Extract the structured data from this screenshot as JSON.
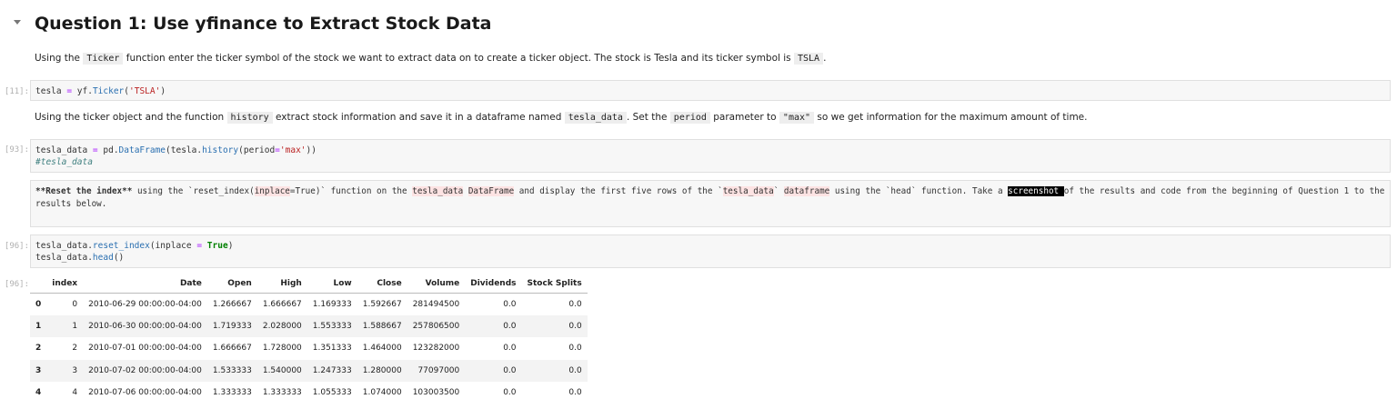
{
  "heading": "Question 1: Use yfinance to Extract Stock Data",
  "md1": {
    "a": "Using the",
    "code1": "Ticker",
    "b": "function enter the ticker symbol of the stock we want to extract data on to create a ticker object. The stock is Tesla and its ticker symbol is",
    "code2": "TSLA",
    "c": "."
  },
  "cell1": {
    "prompt": "[11]:",
    "line_a": "tesla ",
    "eq": "=",
    "line_b": " yf.",
    "fn": "Ticker",
    "line_c": "(",
    "str": "'TSLA'",
    "line_d": ")"
  },
  "md2": {
    "a": "Using the ticker object and the function",
    "code1": "history",
    "b": "extract stock information and save it in a dataframe named",
    "code2": "tesla_data",
    "c": ". Set the",
    "code3": "period",
    "d": "parameter to",
    "code4": "\"max\"",
    "e": "so we get information for the maximum amount of time."
  },
  "cell2": {
    "prompt": "[93]:",
    "a": "tesla_data ",
    "eq": "=",
    "b": " pd.",
    "fn1": "DataFrame",
    "c": "(tesla.",
    "fn2": "history",
    "d": "(period",
    "eq2": "=",
    "str": "'max'",
    "e": "))",
    "comment": "#tesla_data"
  },
  "cell3": {
    "t1": "**Reset the index**",
    "t2": " using the `reset_index(",
    "t3": "inplace",
    "t4": "=True)` function on the ",
    "t5": "tesla_data",
    "t6": " ",
    "t7": "DataFrame",
    "t8": " and display the first five rows of the `",
    "t9": "tesla_data",
    "t10": "` ",
    "t11": "dataframe",
    "t12": " using the `head` function. Take a ",
    "t13": "screenshot ",
    "t14": "of the results and code from the beginning of Question 1 to the results below."
  },
  "cell4": {
    "prompt": "[96]:",
    "l1a": "tesla_data.",
    "l1fn": "reset_index",
    "l1b": "(inplace ",
    "l1eq": "=",
    "l1c": " ",
    "l1kw": "True",
    "l1d": ")",
    "l2a": "tesla_data.",
    "l2fn": "head",
    "l2b": "()"
  },
  "output_prompt": "[96]:",
  "table": {
    "columns": [
      "",
      "index",
      "Date",
      "Open",
      "High",
      "Low",
      "Close",
      "Volume",
      "Dividends",
      "Stock Splits"
    ],
    "rows": [
      [
        "0",
        "0",
        "2010-06-29 00:00:00-04:00",
        "1.266667",
        "1.666667",
        "1.169333",
        "1.592667",
        "281494500",
        "0.0",
        "0.0"
      ],
      [
        "1",
        "1",
        "2010-06-30 00:00:00-04:00",
        "1.719333",
        "2.028000",
        "1.553333",
        "1.588667",
        "257806500",
        "0.0",
        "0.0"
      ],
      [
        "2",
        "2",
        "2010-07-01 00:00:00-04:00",
        "1.666667",
        "1.728000",
        "1.351333",
        "1.464000",
        "123282000",
        "0.0",
        "0.0"
      ],
      [
        "3",
        "3",
        "2010-07-02 00:00:00-04:00",
        "1.533333",
        "1.540000",
        "1.247333",
        "1.280000",
        "77097000",
        "0.0",
        "0.0"
      ],
      [
        "4",
        "4",
        "2010-07-06 00:00:00-04:00",
        "1.333333",
        "1.333333",
        "1.055333",
        "1.074000",
        "103003500",
        "0.0",
        "0.0"
      ]
    ]
  },
  "icons": {
    "collapse": "chevron-down-icon"
  }
}
